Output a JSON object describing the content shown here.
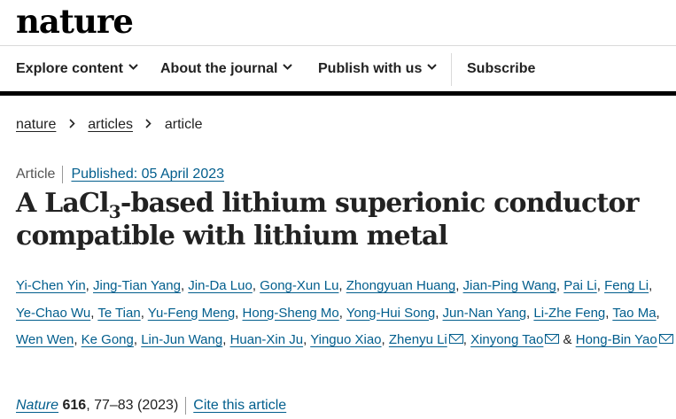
{
  "brand": {
    "logo": "nature"
  },
  "nav": {
    "items": [
      {
        "label": "Explore content",
        "has_menu": true
      },
      {
        "label": "About the journal",
        "has_menu": true
      },
      {
        "label": "Publish with us",
        "has_menu": true
      }
    ],
    "subscribe": "Subscribe"
  },
  "breadcrumb": [
    "nature",
    "articles",
    "article"
  ],
  "article": {
    "type": "Article",
    "published": "Published: 05 April 2023",
    "title_pre": "A LaCl",
    "title_sub": "3",
    "title_post": "-based lithium superionic conductor compatible with lithium metal",
    "authors": [
      {
        "name": "Yi-Chen Yin",
        "email": false
      },
      {
        "name": "Jing-Tian Yang",
        "email": false
      },
      {
        "name": "Jin-Da Luo",
        "email": false
      },
      {
        "name": "Gong-Xun Lu",
        "email": false
      },
      {
        "name": "Zhongyuan Huang",
        "email": false
      },
      {
        "name": "Jian-Ping Wang",
        "email": false
      },
      {
        "name": "Pai Li",
        "email": false
      },
      {
        "name": "Feng Li",
        "email": false
      },
      {
        "name": "Ye-Chao Wu",
        "email": false
      },
      {
        "name": "Te Tian",
        "email": false
      },
      {
        "name": "Yu-Feng Meng",
        "email": false
      },
      {
        "name": "Hong-Sheng Mo",
        "email": false
      },
      {
        "name": "Yong-Hui Song",
        "email": false
      },
      {
        "name": "Jun-Nan Yang",
        "email": false
      },
      {
        "name": "Li-Zhe Feng",
        "email": false
      },
      {
        "name": "Tao Ma",
        "email": false
      },
      {
        "name": "Wen Wen",
        "email": false
      },
      {
        "name": "Ke Gong",
        "email": false
      },
      {
        "name": "Lin-Jun Wang",
        "email": false
      },
      {
        "name": "Huan-Xin Ju",
        "email": false
      },
      {
        "name": "Yinguo Xiao",
        "email": false
      },
      {
        "name": "Zhenyu Li",
        "email": true
      },
      {
        "name": "Xinyong Tao",
        "email": true
      },
      {
        "name": "Hong-Bin Yao",
        "email": true
      }
    ],
    "citation": {
      "journal": "Nature",
      "volume": "616",
      "pages_year": ", 77–83 (2023)",
      "cite_link": "Cite this article"
    }
  },
  "colors": {
    "link": "#025e8d",
    "text": "#222222",
    "nav_border": "#000000",
    "divider": "#dadada"
  },
  "icons": {
    "nav_menu": "chevron-down-icon",
    "breadcrumb_separator": "chevron-right-icon",
    "author_contact": "mail-icon"
  }
}
